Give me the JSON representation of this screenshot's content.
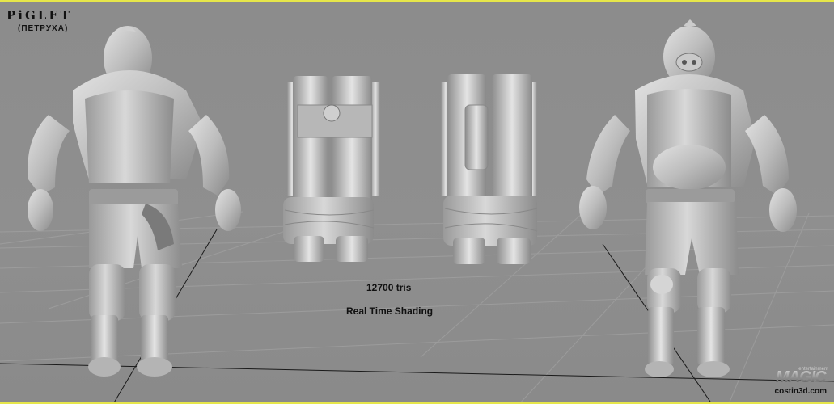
{
  "header": {
    "title": "PiGLET",
    "subtitle": "(ПЕТРУХА)"
  },
  "stats": {
    "tris": "12700 tris",
    "shading": "Real Time Shading"
  },
  "branding": {
    "logo_text": "MAGIC",
    "logo_small": "entertainment",
    "url": "costin3d.com"
  },
  "colors": {
    "background": "#8e8e8e",
    "border": "#e6e64a",
    "model": "#c4c4c4",
    "grid": "#a8a8a8"
  },
  "views": [
    "back-view",
    "backpack-front",
    "backpack-back",
    "front-view"
  ]
}
